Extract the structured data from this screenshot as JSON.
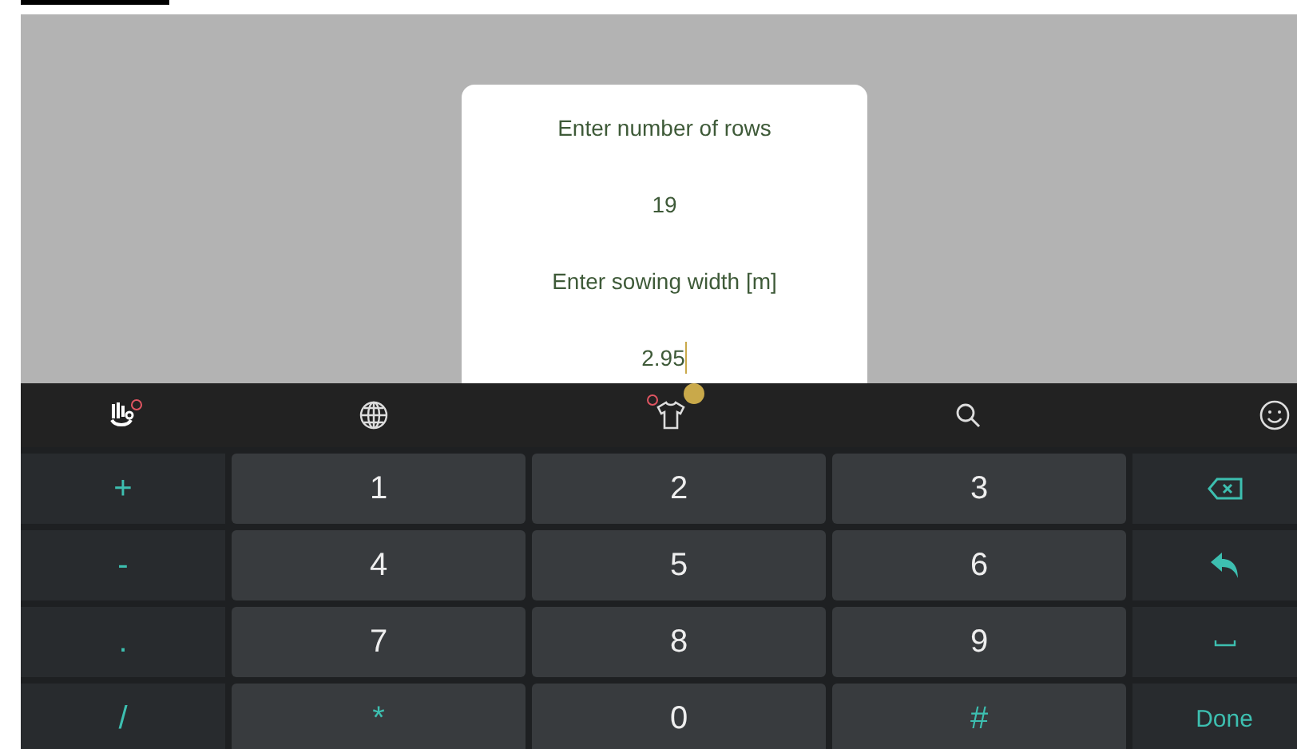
{
  "dialog": {
    "fields": [
      {
        "label": "Enter number of rows",
        "value": "19",
        "focused": false
      },
      {
        "label": "Enter sowing width [m]",
        "value": "2.95",
        "focused": true
      }
    ]
  },
  "keyboard": {
    "rows": [
      [
        {
          "kind": "symbol",
          "label": "+"
        },
        {
          "kind": "digit",
          "label": "1"
        },
        {
          "kind": "digit",
          "label": "2"
        },
        {
          "kind": "digit",
          "label": "3"
        },
        {
          "kind": "backspace"
        }
      ],
      [
        {
          "kind": "symbol",
          "label": "-"
        },
        {
          "kind": "digit",
          "label": "4"
        },
        {
          "kind": "digit",
          "label": "5"
        },
        {
          "kind": "digit",
          "label": "6"
        },
        {
          "kind": "enter"
        }
      ],
      [
        {
          "kind": "symbol",
          "label": "."
        },
        {
          "kind": "digit",
          "label": "7"
        },
        {
          "kind": "digit",
          "label": "8"
        },
        {
          "kind": "digit",
          "label": "9"
        },
        {
          "kind": "space"
        }
      ],
      [
        {
          "kind": "symbol",
          "label": "/"
        },
        {
          "kind": "symbol",
          "label": "*"
        },
        {
          "kind": "digit",
          "label": "0"
        },
        {
          "kind": "symbol",
          "label": "#"
        },
        {
          "kind": "done",
          "label": "Done"
        }
      ]
    ]
  }
}
